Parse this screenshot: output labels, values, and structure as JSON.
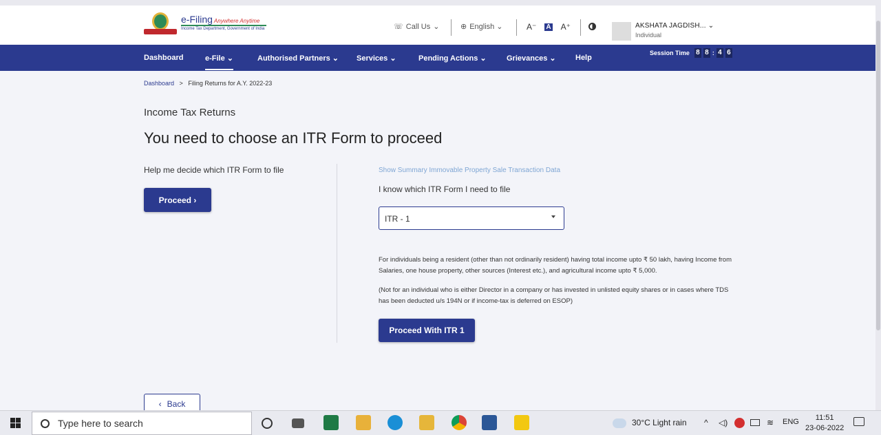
{
  "header": {
    "logo_main": "e-Filing",
    "logo_tagline": "Anywhere Anytime",
    "logo_sub": "Income Tax Department, Government of India",
    "call_us": "Call Us",
    "language": "English",
    "font_decrease": "A⁻",
    "font_normal": "A",
    "font_increase": "A⁺",
    "user_name": "AKSHATA JAGDISH...",
    "user_role": "Individual"
  },
  "nav": {
    "items": [
      {
        "label": "Dashboard"
      },
      {
        "label": "e-File ⌄"
      },
      {
        "label": "Authorised Partners ⌄"
      },
      {
        "label": "Services ⌄"
      },
      {
        "label": "Pending Actions ⌄"
      },
      {
        "label": "Grievances ⌄"
      },
      {
        "label": "Help"
      }
    ],
    "session_label": "Session Time",
    "session_digits": [
      "8",
      "8",
      ":",
      "4",
      "6"
    ]
  },
  "breadcrumb": {
    "home": "Dashboard",
    "sep": ">",
    "current": "Filing Returns for A.Y. 2022-23"
  },
  "main": {
    "section_title": "Income Tax Returns",
    "heading": "You need to choose an ITR Form to proceed",
    "help_text": "Help me decide which ITR Form to file",
    "proceed_label": "Proceed  ›",
    "summary_link": "Show Summary Immovable Property Sale Transaction Data",
    "know_text": "I know which ITR Form I need to file",
    "selected_form": "ITR - 1",
    "desc1": "For individuals being a resident (other than not ordinarily resident) having total income upto ₹ 50 lakh, having Income from Salaries, one house property, other sources (Interest etc.), and agricultural income upto ₹ 5,000.",
    "desc2": "(Not for an individual who is either Director in a company or has invested in unlisted equity shares or in cases where TDS has been deducted u/s 194N or if income-tax is deferred on ESOP)",
    "proceed_itr_label": "Proceed With ITR 1",
    "back_label": "Back",
    "back_chevron": "‹"
  },
  "taskbar": {
    "search_placeholder": "Type here to search",
    "weather": "30°C  Light rain",
    "lang": "ENG",
    "time": "11:51",
    "date": "23-06-2022"
  },
  "colors": {
    "brand": "#2b3a8f",
    "background": "#f3f4f9"
  }
}
